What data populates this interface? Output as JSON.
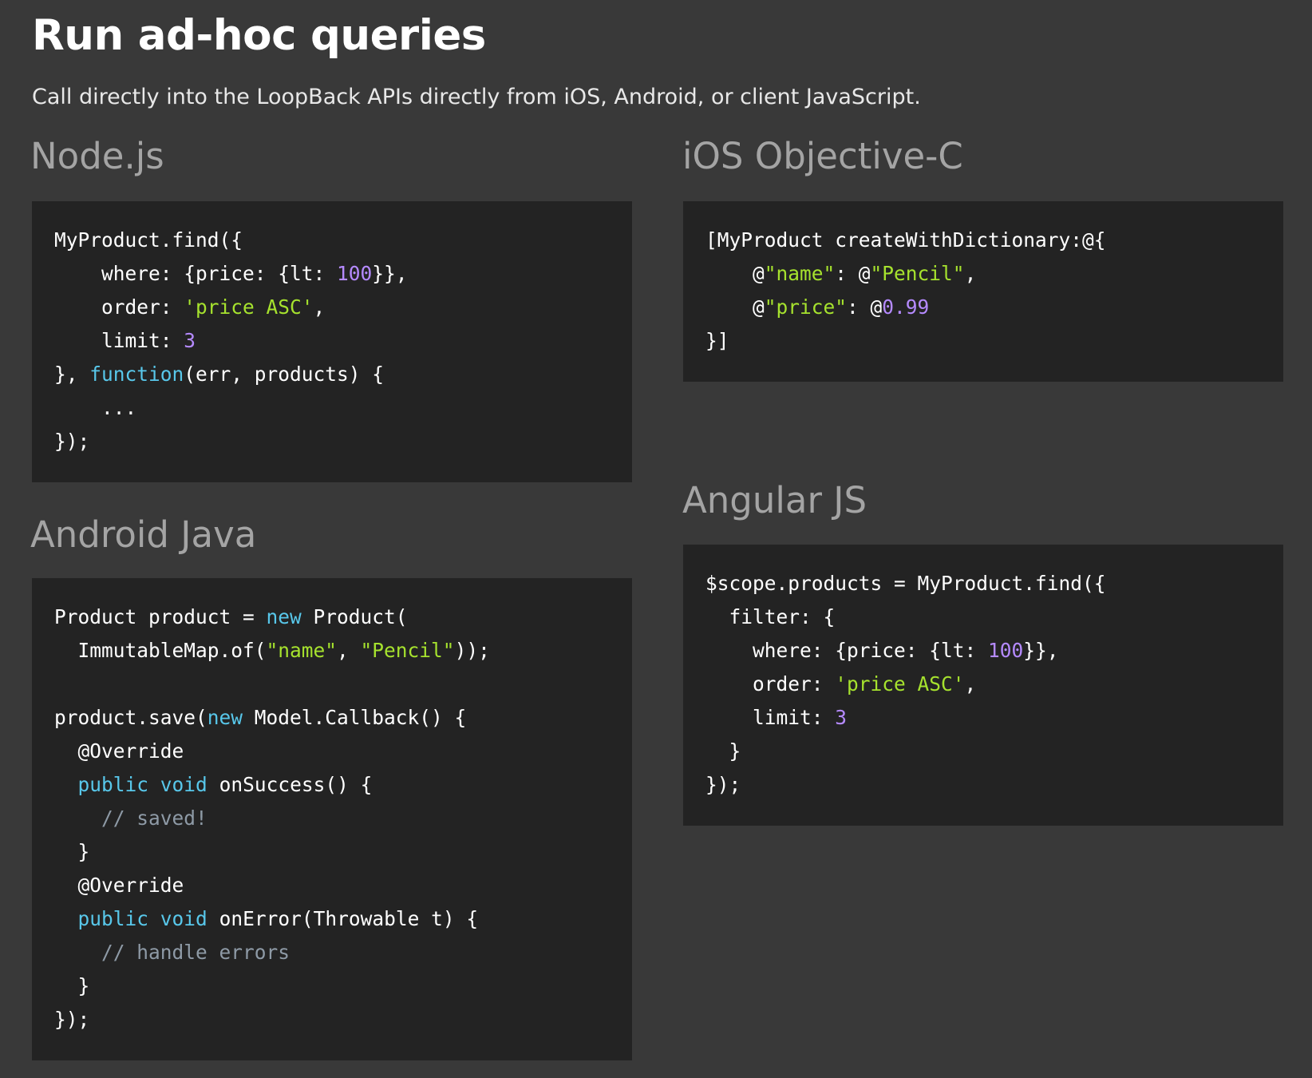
{
  "header": {
    "title": "Run ad-hoc queries",
    "subtitle": "Call directly into the LoopBack APIs directly from iOS, Android, or client JavaScript."
  },
  "colors": {
    "background": "#393939",
    "code_background": "#232323",
    "heading_text": "#a4a4a4",
    "keyword": "#58c7ea",
    "string": "#a6e22e",
    "number": "#b58aff",
    "comment": "#8e9aa6"
  },
  "sections": [
    {
      "id": "node",
      "heading": "Node.js",
      "lines": [
        [
          {
            "t": "MyProduct.find({",
            "k": "plain"
          }
        ],
        [
          {
            "t": "    where: {price: {lt: ",
            "k": "plain"
          },
          {
            "t": "100",
            "k": "num"
          },
          {
            "t": "}},",
            "k": "plain"
          }
        ],
        [
          {
            "t": "    order: ",
            "k": "plain"
          },
          {
            "t": "'price ASC'",
            "k": "str"
          },
          {
            "t": ",",
            "k": "plain"
          }
        ],
        [
          {
            "t": "    limit: ",
            "k": "plain"
          },
          {
            "t": "3",
            "k": "num"
          }
        ],
        [
          {
            "t": "}, ",
            "k": "plain"
          },
          {
            "t": "function",
            "k": "kw"
          },
          {
            "t": "(err, products) {",
            "k": "plain"
          }
        ],
        [
          {
            "t": "    ...",
            "k": "plain"
          }
        ],
        [
          {
            "t": "});",
            "k": "plain"
          }
        ]
      ]
    },
    {
      "id": "ios",
      "heading": "iOS Objective-C",
      "lines": [
        [
          {
            "t": "[MyProduct createWithDictionary:@{",
            "k": "plain"
          }
        ],
        [
          {
            "t": "    @",
            "k": "plain"
          },
          {
            "t": "\"name\"",
            "k": "str"
          },
          {
            "t": ": @",
            "k": "plain"
          },
          {
            "t": "\"Pencil\"",
            "k": "str"
          },
          {
            "t": ",",
            "k": "plain"
          }
        ],
        [
          {
            "t": "    @",
            "k": "plain"
          },
          {
            "t": "\"price\"",
            "k": "str"
          },
          {
            "t": ": @",
            "k": "plain"
          },
          {
            "t": "0.99",
            "k": "num"
          }
        ],
        [
          {
            "t": "}]",
            "k": "plain"
          }
        ]
      ]
    },
    {
      "id": "android",
      "heading": "Android Java",
      "lines": [
        [
          {
            "t": "Product product = ",
            "k": "plain"
          },
          {
            "t": "new",
            "k": "kw"
          },
          {
            "t": " Product(",
            "k": "plain"
          }
        ],
        [
          {
            "t": "  ImmutableMap.of(",
            "k": "plain"
          },
          {
            "t": "\"name\"",
            "k": "str"
          },
          {
            "t": ", ",
            "k": "plain"
          },
          {
            "t": "\"Pencil\"",
            "k": "str"
          },
          {
            "t": "));",
            "k": "plain"
          }
        ],
        [
          {
            "t": "",
            "k": "plain"
          }
        ],
        [
          {
            "t": "product.save(",
            "k": "plain"
          },
          {
            "t": "new",
            "k": "kw"
          },
          {
            "t": " Model.Callback() {",
            "k": "plain"
          }
        ],
        [
          {
            "t": "  @Override",
            "k": "plain"
          }
        ],
        [
          {
            "t": "  ",
            "k": "plain"
          },
          {
            "t": "public",
            "k": "kw"
          },
          {
            "t": " ",
            "k": "plain"
          },
          {
            "t": "void",
            "k": "kw"
          },
          {
            "t": " onSuccess() {",
            "k": "plain"
          }
        ],
        [
          {
            "t": "    // saved!",
            "k": "com"
          }
        ],
        [
          {
            "t": "  }",
            "k": "plain"
          }
        ],
        [
          {
            "t": "  @Override",
            "k": "plain"
          }
        ],
        [
          {
            "t": "  ",
            "k": "plain"
          },
          {
            "t": "public",
            "k": "kw"
          },
          {
            "t": " ",
            "k": "plain"
          },
          {
            "t": "void",
            "k": "kw"
          },
          {
            "t": " onError(Throwable t) {",
            "k": "plain"
          }
        ],
        [
          {
            "t": "    // handle errors",
            "k": "com"
          }
        ],
        [
          {
            "t": "  }",
            "k": "plain"
          }
        ],
        [
          {
            "t": "});",
            "k": "plain"
          }
        ]
      ]
    },
    {
      "id": "angular",
      "heading": "Angular JS",
      "lines": [
        [
          {
            "t": "$scope.products = MyProduct.find({",
            "k": "plain"
          }
        ],
        [
          {
            "t": "  filter: {",
            "k": "plain"
          }
        ],
        [
          {
            "t": "    where: {price: {lt: ",
            "k": "plain"
          },
          {
            "t": "100",
            "k": "num"
          },
          {
            "t": "}},",
            "k": "plain"
          }
        ],
        [
          {
            "t": "    order: ",
            "k": "plain"
          },
          {
            "t": "'price ASC'",
            "k": "str"
          },
          {
            "t": ",",
            "k": "plain"
          }
        ],
        [
          {
            "t": "    limit: ",
            "k": "plain"
          },
          {
            "t": "3",
            "k": "num"
          }
        ],
        [
          {
            "t": "  }",
            "k": "plain"
          }
        ],
        [
          {
            "t": "});",
            "k": "plain"
          }
        ]
      ]
    }
  ]
}
